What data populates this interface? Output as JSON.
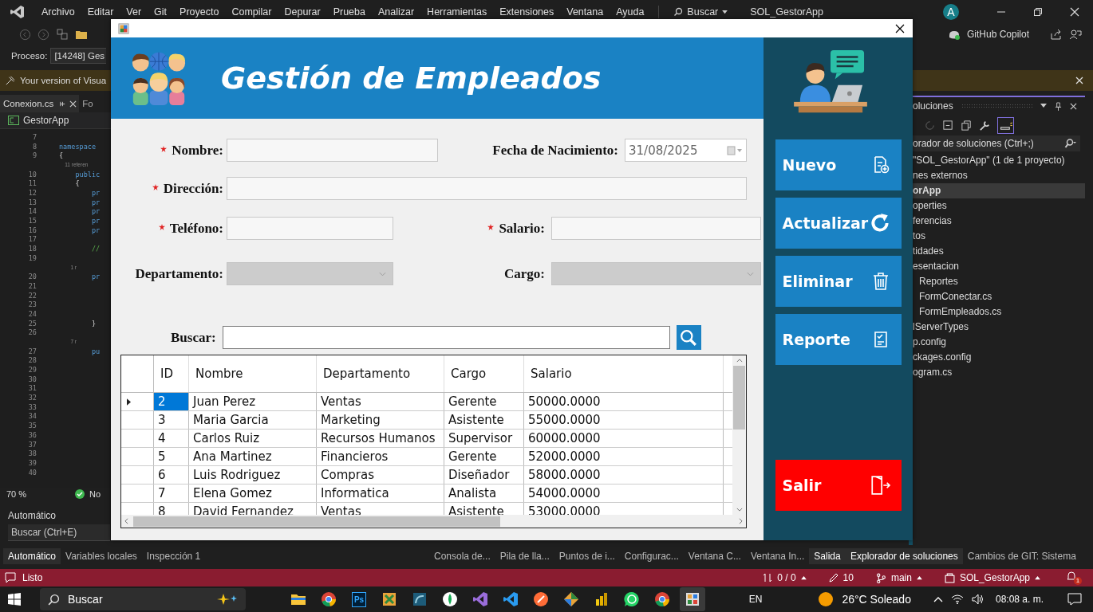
{
  "ide": {
    "menu": [
      "Archivo",
      "Editar",
      "Ver",
      "Git",
      "Proyecto",
      "Compilar",
      "Depurar",
      "Prueba",
      "Analizar",
      "Herramientas",
      "Extensiones",
      "Ventana",
      "Ayuda"
    ],
    "search_label": "Buscar",
    "solution_title": "SOL_GestorApp",
    "avatar": "A",
    "copilot": "GitHub Copilot",
    "process": {
      "label": "Proceso:",
      "value": "[14248] Ges"
    },
    "info_bar": "Your version of Visua",
    "editor": {
      "tabs": [
        {
          "label": "Conexion.cs",
          "selected": true
        },
        {
          "label": "Fo",
          "selected": false
        }
      ],
      "scope": "GestorApp",
      "lines": [
        {
          "number": "7"
        },
        {
          "number": "8",
          "code": "namespace",
          "kind": "keyword"
        },
        {
          "number": "9",
          "code": "{",
          "kind": "plain"
        },
        {
          "code": "    11 referen",
          "kind": "lens"
        },
        {
          "number": "10",
          "code": "    public",
          "kind": "keyword"
        },
        {
          "number": "11",
          "code": "    {",
          "kind": "plain"
        },
        {
          "number": "12",
          "code": "        pr",
          "kind": "keyword"
        },
        {
          "number": "13",
          "code": "        pr",
          "kind": "keyword"
        },
        {
          "number": "14",
          "code": "        pr",
          "kind": "keyword"
        },
        {
          "number": "15",
          "code": "        pr",
          "kind": "keyword"
        },
        {
          "number": "16",
          "code": "        pr",
          "kind": "keyword"
        },
        {
          "number": "17"
        },
        {
          "number": "18",
          "code": "        //",
          "kind": "comment"
        },
        {
          "number": "19"
        },
        {
          "code": "        1 r",
          "kind": "lens"
        },
        {
          "number": "20",
          "code": "        pr",
          "kind": "keyword"
        },
        {
          "number": "21"
        },
        {
          "number": "22"
        },
        {
          "number": "23"
        },
        {
          "number": "24"
        },
        {
          "number": "25",
          "code": "        }",
          "kind": "plain"
        },
        {
          "number": "26"
        },
        {
          "code": "        7 r",
          "kind": "lens"
        },
        {
          "number": "27",
          "code": "        pu",
          "kind": "keyword"
        },
        {
          "number": "28"
        },
        {
          "number": "29"
        },
        {
          "number": "30"
        },
        {
          "number": "31"
        },
        {
          "number": "32"
        },
        {
          "number": "33"
        },
        {
          "number": "34"
        },
        {
          "number": "35"
        },
        {
          "number": "36"
        },
        {
          "number": "37"
        },
        {
          "number": "38"
        },
        {
          "number": "39"
        },
        {
          "number": "40"
        }
      ],
      "zoom": "70 %",
      "status": "No"
    },
    "locals": {
      "title": "Automático",
      "search_placeholder": "Buscar (Ctrl+E)"
    },
    "solution_explorer": {
      "title": "oluciones",
      "search_placeholder": "orador de soluciones (Ctrl+;)",
      "tree": [
        {
          "label": "\"SOL_GestorApp\"  (1 de 1 proyecto)",
          "selected": false
        },
        {
          "label": "nes externos",
          "selected": false
        },
        {
          "label": "orApp",
          "selected": true,
          "children": [
            {
              "label": "operties",
              "selected": false
            },
            {
              "label": "ferencias",
              "selected": false
            },
            {
              "label": "tos",
              "selected": false
            },
            {
              "label": "tidades",
              "selected": false
            },
            {
              "label": "esentacion",
              "selected": false,
              "children": [
                {
                  "label": "Reportes",
                  "selected": false
                },
                {
                  "label": "FormConectar.cs",
                  "selected": false
                },
                {
                  "label": "FormEmpleados.cs",
                  "selected": false
                }
              ]
            },
            {
              "label": "lServerTypes",
              "selected": false
            },
            {
              "label": "p.config",
              "selected": false
            },
            {
              "label": "ckages.config",
              "selected": false
            },
            {
              "label": "ogram.cs",
              "selected": false
            }
          ]
        }
      ]
    },
    "bottom_tabs": [
      [
        {
          "label": "Automático",
          "selected": true
        },
        {
          "label": "Variables locales",
          "selected": false
        },
        {
          "label": "Inspección 1",
          "selected": false
        }
      ],
      [
        {
          "label": "Consola de...",
          "selected": false
        },
        {
          "label": "Pila de lla...",
          "selected": false
        },
        {
          "label": "Puntos de i...",
          "selected": false
        },
        {
          "label": "Configurac...",
          "selected": false
        },
        {
          "label": "Ventana C...",
          "selected": false
        },
        {
          "label": "Ventana In...",
          "selected": false
        },
        {
          "label": "Salida",
          "selected": true
        }
      ],
      [
        {
          "label": "Explorador de soluciones",
          "selected": true
        },
        {
          "label": "Cambios de GIT: Sistema",
          "selected": false
        }
      ]
    ],
    "status_bar": {
      "state": "Listo",
      "sync": "0 / 0",
      "edits": "10",
      "branch": "main",
      "repo": "SOL_GestorApp",
      "notifications": "1"
    }
  },
  "taskbar": {
    "search": "Buscar",
    "apps": [
      {
        "kind": "folder",
        "selected": false
      },
      {
        "kind": "chrome",
        "selected": false
      },
      {
        "kind": "ps",
        "label": "Ps",
        "selected": false
      },
      {
        "kind": "tool",
        "selected": false
      },
      {
        "kind": "dolphin",
        "selected": false
      },
      {
        "kind": "leaf",
        "selected": false
      },
      {
        "kind": "vs",
        "selected": false
      },
      {
        "kind": "vscode",
        "selected": false
      },
      {
        "kind": "postman",
        "selected": false
      },
      {
        "kind": "git",
        "selected": false
      },
      {
        "kind": "bars",
        "selected": false
      },
      {
        "kind": "whatsapp",
        "selected": false
      },
      {
        "kind": "chrome",
        "selected": false
      },
      {
        "kind": "form",
        "selected": true
      }
    ],
    "language": "EN",
    "weather": "26°C Soleado",
    "time": "08:08 a. m."
  },
  "form": {
    "title": "Gestión de Empleados",
    "rows": [
      [
        {
          "label": "Nombre:",
          "required": true,
          "kind": "text",
          "disabled": false
        },
        {
          "label": "Fecha de Nacimiento:",
          "required": false,
          "kind": "date",
          "value": "31/08/2025",
          "disabled": false
        }
      ],
      [
        {
          "label": "Dirección:",
          "required": true,
          "kind": "text",
          "disabled": false
        }
      ],
      [
        {
          "label": "Teléfono:",
          "required": true,
          "kind": "text",
          "disabled": false
        },
        {
          "label": "Salario:",
          "required": true,
          "kind": "text",
          "disabled": false
        }
      ],
      [
        {
          "label": "Departamento:",
          "required": false,
          "kind": "combo",
          "disabled": true
        },
        {
          "label": "Cargo:",
          "required": false,
          "kind": "combo",
          "disabled": true
        }
      ]
    ],
    "search": {
      "label": "Buscar:"
    },
    "buttons": [
      {
        "label": "Nuevo",
        "kind": "new"
      },
      {
        "label": "Actualizar",
        "kind": "refresh"
      },
      {
        "label": "Eliminar",
        "kind": "delete"
      },
      {
        "label": "Reporte",
        "kind": "report"
      },
      {
        "label": "Salir",
        "kind": "exit"
      }
    ],
    "table": {
      "columns": [
        "ID",
        "Nombre",
        "Departamento",
        "Cargo",
        "Salario"
      ],
      "rows": [
        {
          "selected": true,
          "cells": [
            "2",
            "Juan Perez",
            "Ventas",
            "Gerente",
            "50000.0000"
          ]
        },
        {
          "selected": false,
          "cells": [
            "3",
            "Maria Garcia",
            "Marketing",
            "Asistente",
            "55000.0000"
          ]
        },
        {
          "selected": false,
          "cells": [
            "4",
            "Carlos Ruiz",
            "Recursos Humanos",
            "Supervisor",
            "60000.0000"
          ]
        },
        {
          "selected": false,
          "cells": [
            "5",
            "Ana Martinez",
            "Financieros",
            "Gerente",
            "52000.0000"
          ]
        },
        {
          "selected": false,
          "cells": [
            "6",
            "Luis Rodriguez",
            "Compras",
            "Diseñador",
            "58000.0000"
          ]
        },
        {
          "selected": false,
          "cells": [
            "7",
            "Elena Gomez",
            "Informatica",
            "Analista",
            "54000.0000"
          ]
        },
        {
          "selected": false,
          "cells": [
            "8",
            "David Fernandez",
            "Ventas",
            "Asistente",
            "53000.0000"
          ]
        }
      ]
    }
  }
}
